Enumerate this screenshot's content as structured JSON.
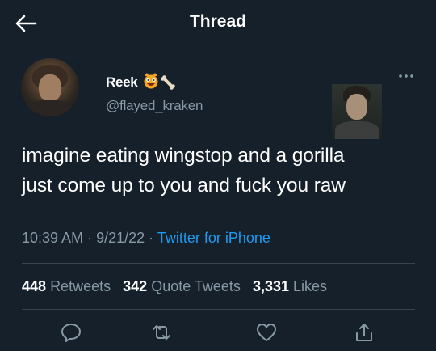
{
  "header": {
    "title": "Thread"
  },
  "tweet": {
    "author": {
      "display_name": "Reek",
      "handle": "@flayed_kraken"
    },
    "text_line1": "imagine eating wingstop and a gorilla",
    "text_line2": "just come up to you and fuck you raw",
    "time": "10:39 AM",
    "date": "9/21/22",
    "source": "Twitter for iPhone",
    "sep": "·"
  },
  "stats": {
    "retweets_count": "448",
    "retweets_label": "Retweets",
    "quote_count": "342",
    "quote_label": "Quote Tweets",
    "likes_count": "3,331",
    "likes_label": "Likes"
  },
  "icons": {
    "back": "arrow-left-icon",
    "more": "more-horizontal-icon",
    "reply": "reply-icon",
    "retweet": "retweet-icon",
    "like": "like-icon",
    "share": "share-icon"
  },
  "colors": {
    "background": "#15202b",
    "text": "#ffffff",
    "secondary": "#8899a6",
    "accent": "#1d9bf0",
    "divider": "#38444d"
  }
}
